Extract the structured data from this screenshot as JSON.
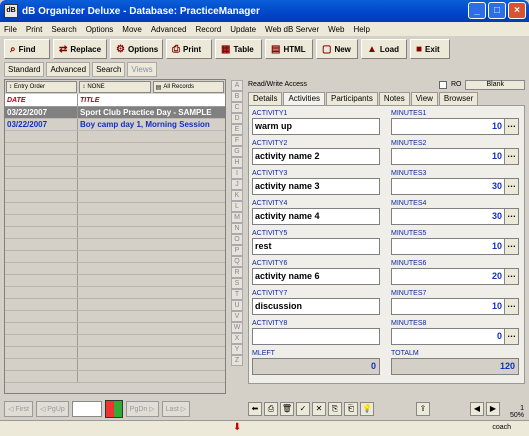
{
  "window": {
    "title": "dB Organizer Deluxe - Database: PracticeManager",
    "app_icon_text": "dB"
  },
  "menu": [
    "File",
    "Print",
    "Search",
    "Options",
    "Move",
    "Advanced",
    "Record",
    "Update",
    "Web dB Server",
    "Web",
    "Help"
  ],
  "toolbar": [
    {
      "label": "Find",
      "icon": "binoculars-icon"
    },
    {
      "label": "Replace",
      "icon": "replace-icon"
    },
    {
      "label": "Options",
      "icon": "options-icon"
    },
    {
      "label": "Print",
      "icon": "printer-icon"
    },
    {
      "label": "Table",
      "icon": "table-icon"
    },
    {
      "label": "HTML",
      "icon": "html-icon"
    },
    {
      "label": "New",
      "icon": "new-icon"
    },
    {
      "label": "Load",
      "icon": "load-icon"
    },
    {
      "label": "Exit",
      "icon": "exit-icon"
    }
  ],
  "view_tabs": [
    "Standard",
    "Advanced",
    "Search",
    "Views"
  ],
  "list": {
    "buttons": [
      "Entry Order",
      "NONE",
      "All Records"
    ],
    "columns": [
      "DATE",
      "TITLE"
    ],
    "rows": [
      {
        "date": "03/22/2007",
        "title": "Sport Club Practice Day - SAMPLE",
        "selected": true
      },
      {
        "date": "03/22/2007",
        "title": "Boy camp day 1, Morning Session",
        "selected": false
      }
    ]
  },
  "nav": {
    "first": "First",
    "pgup": "PgUp",
    "pgdn": "PgDn",
    "last": "Last"
  },
  "alphabet": [
    "A",
    "B",
    "C",
    "D",
    "E",
    "F",
    "G",
    "H",
    "I",
    "J",
    "K",
    "L",
    "M",
    "N",
    "O",
    "P",
    "Q",
    "R",
    "S",
    "T",
    "U",
    "V",
    "W",
    "X",
    "Y",
    "Z"
  ],
  "record": {
    "access": "Read/Write Access",
    "ro": "RO",
    "blank": "Blank",
    "tabs": [
      "Details",
      "Activities",
      "Participants",
      "Notes",
      "View",
      "Browser"
    ],
    "active_tab": "Activities",
    "activities": [
      {
        "label": "ACTIVITY1",
        "value": "warm up",
        "min_label": "MINUTES1",
        "minutes": "10"
      },
      {
        "label": "ACTIVITY2",
        "value": "activity name 2",
        "min_label": "MINUTES2",
        "minutes": "10"
      },
      {
        "label": "ACTIVITY3",
        "value": "activity name 3",
        "min_label": "MINUTES3",
        "minutes": "30"
      },
      {
        "label": "ACTIVITY4",
        "value": "activity name 4",
        "min_label": "MINUTES4",
        "minutes": "30"
      },
      {
        "label": "ACTIVITY5",
        "value": "rest",
        "min_label": "MINUTES5",
        "minutes": "10"
      },
      {
        "label": "ACTIVITY6",
        "value": "activity name 6",
        "min_label": "MINUTES6",
        "minutes": "20"
      },
      {
        "label": "ACTIVITY7",
        "value": "discussion",
        "min_label": "MINUTES7",
        "minutes": "10"
      },
      {
        "label": "ACTIVITY8",
        "value": "",
        "min_label": "MINUTES8",
        "minutes": "0"
      }
    ],
    "mleft_label": "MLEFT",
    "mleft": "0",
    "totalm_label": "TOTALM",
    "totalm": "120"
  },
  "status": {
    "page": "1",
    "zoom": "50%",
    "user": "coach"
  }
}
